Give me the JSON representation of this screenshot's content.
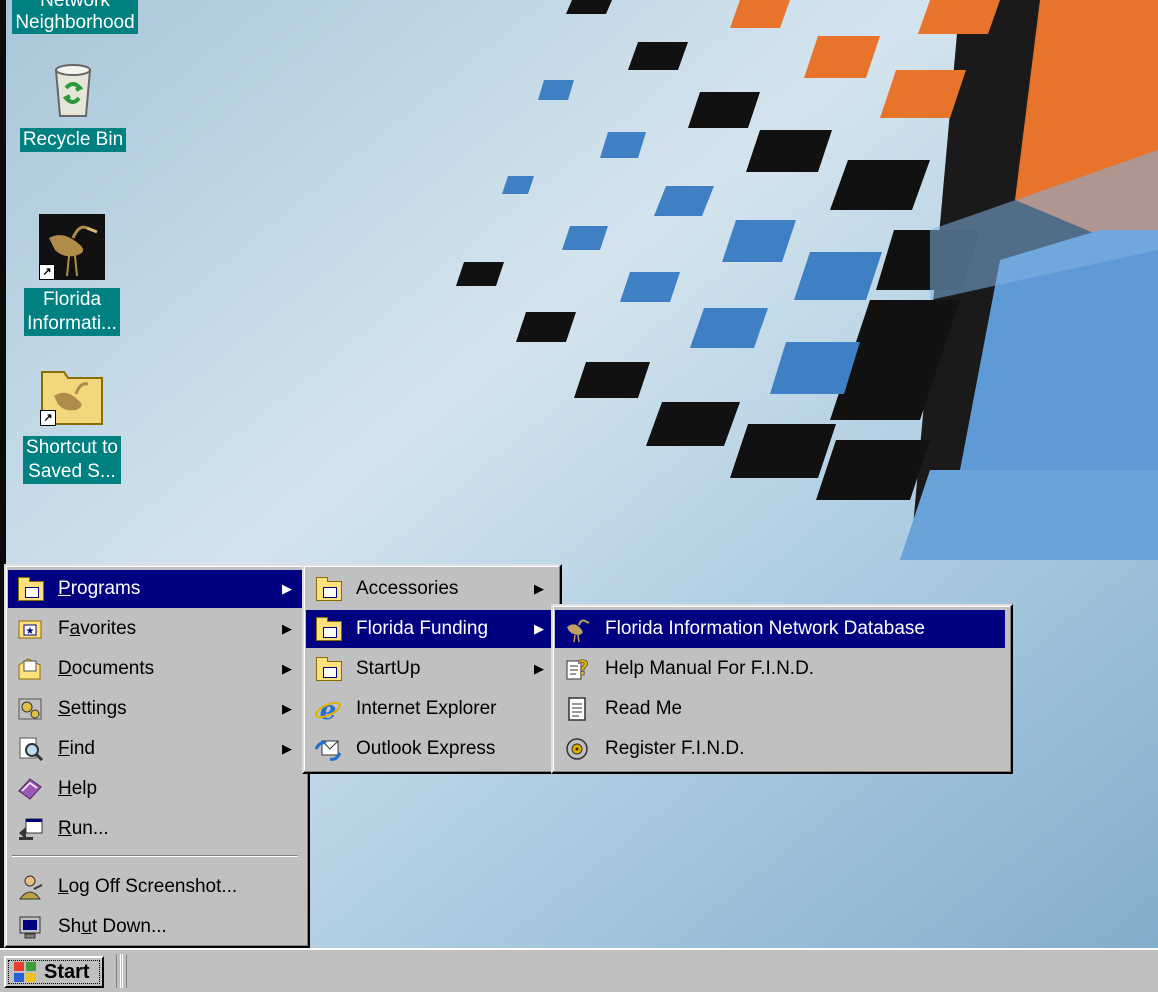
{
  "desktop": {
    "icons": [
      {
        "name": "network-neighborhood",
        "label_line1": "Network",
        "label_line2": "Neighborhood"
      },
      {
        "name": "recycle-bin",
        "label_line1": "Recycle Bin"
      },
      {
        "name": "florida-information",
        "label_line1": "Florida",
        "label_line2": "Informati..."
      },
      {
        "name": "shortcut-saved",
        "label_line1": "Shortcut to",
        "label_line2": "Saved S..."
      }
    ]
  },
  "start_menu": {
    "items": [
      {
        "label": "Programs",
        "u": "P",
        "rest": "rograms",
        "submenu": true,
        "icon": "programs-folder-icon"
      },
      {
        "label": "Favorites",
        "pre": "F",
        "u": "a",
        "rest": "vorites",
        "submenu": true,
        "icon": "favorites-icon"
      },
      {
        "label": "Documents",
        "u": "D",
        "rest": "ocuments",
        "submenu": true,
        "icon": "documents-icon"
      },
      {
        "label": "Settings",
        "u": "S",
        "rest": "ettings",
        "submenu": true,
        "icon": "settings-icon"
      },
      {
        "label": "Find",
        "u": "F",
        "rest": "ind",
        "submenu": true,
        "icon": "find-icon"
      },
      {
        "label": "Help",
        "u": "H",
        "rest": "elp",
        "submenu": false,
        "icon": "help-icon"
      },
      {
        "label": "Run...",
        "u": "R",
        "rest": "un...",
        "submenu": false,
        "icon": "run-icon"
      },
      {
        "label": "Log Off Screenshot...",
        "pre": "",
        "u": "L",
        "rest": "og Off Screenshot...",
        "submenu": false,
        "icon": "log-off-icon"
      },
      {
        "label": "Shut Down...",
        "pre": "Sh",
        "u": "u",
        "rest": "t Down...",
        "submenu": false,
        "icon": "shut-down-icon"
      }
    ]
  },
  "programs_menu": {
    "items": [
      {
        "label": "Accessories",
        "submenu": true
      },
      {
        "label": "Florida Funding",
        "submenu": true
      },
      {
        "label": "StartUp",
        "submenu": true
      },
      {
        "label": "Internet Explorer",
        "submenu": false
      },
      {
        "label": "Outlook Express",
        "submenu": false
      }
    ]
  },
  "florida_menu": {
    "items": [
      {
        "label": "Florida Information Network Database"
      },
      {
        "label": "Help Manual For F.I.N.D."
      },
      {
        "label": "Read Me"
      },
      {
        "label": "Register F.I.N.D."
      }
    ]
  },
  "taskbar": {
    "start_label": "Start"
  },
  "colors": {
    "menu_bg": "#c0c0c0",
    "selection": "#000080",
    "desktop_label_bg": "#008080"
  }
}
